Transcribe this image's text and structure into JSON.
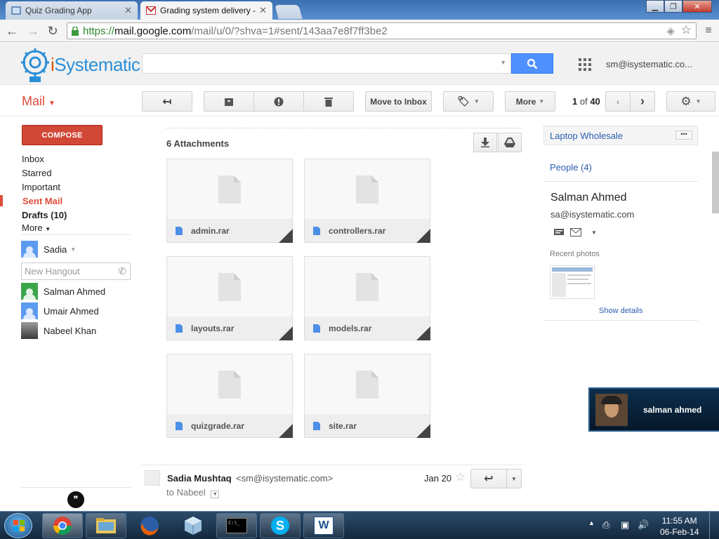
{
  "browser": {
    "tabs": [
      {
        "title": "Quiz Grading App",
        "active": false
      },
      {
        "title": "Grading system delivery -",
        "active": true
      }
    ],
    "url": {
      "scheme": "https://",
      "host": "mail.google.com",
      "path": "/mail/u/0/?shva=1#sent/143aa7e8f7ff3be2"
    }
  },
  "header": {
    "logo_text_i": "i",
    "logo_text_rest": "Systematic",
    "account": "sm@isystematic.co..."
  },
  "toolbar": {
    "mail_label": "Mail",
    "move_to_inbox": "Move to Inbox",
    "more": "More",
    "pager_range": "1",
    "pager_of": "of",
    "pager_total": "40"
  },
  "nav": {
    "compose": "COMPOSE",
    "items": [
      "Inbox",
      "Starred",
      "Important",
      "Sent Mail",
      "Drafts (10)",
      "More"
    ],
    "hangout_user": "Sadia",
    "hangout_placeholder": "New Hangout",
    "contacts": [
      "Salman Ahmed",
      "Umair Ahmed",
      "Nabeel Khan"
    ]
  },
  "attachments": {
    "title": "6 Attachments",
    "files": [
      "admin.rar",
      "controllers.rar",
      "layouts.rar",
      "models.rar",
      "quizgrade.rar",
      "site.rar"
    ]
  },
  "message": {
    "sender_name": "Sadia Mushtaq",
    "sender_email": "<sm@isystematic.com>",
    "date": "Jan 20",
    "to": "to Nabeel"
  },
  "right_panel": {
    "top_link": "Laptop Wholesale",
    "people": "People (4)",
    "contact_name": "Salman Ahmed",
    "contact_email": "sa@isystematic.com",
    "recent_photos": "Recent photos",
    "show_details": "Show details"
  },
  "chat_popup": {
    "name": "salman ahmed"
  },
  "taskbar": {
    "time": "11:55 AM",
    "date": "06-Feb-14"
  }
}
